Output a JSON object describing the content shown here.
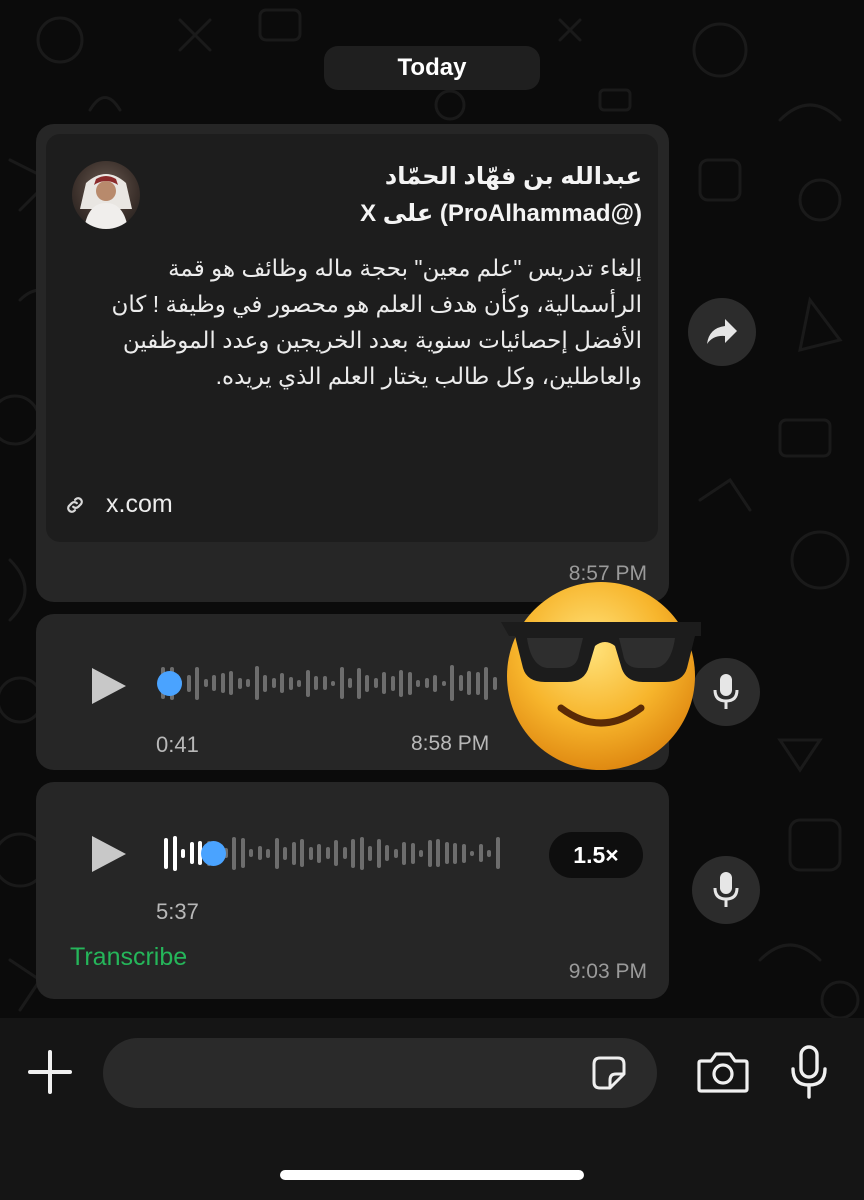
{
  "chat": {
    "date_label": "Today"
  },
  "link_message": {
    "author_line": "عبدالله بن فهّاد الحمّاد",
    "handle_line": "(@ProAlhammad) على X",
    "body": "إلغاء تدريس \"علم معين\" بحجة ماله وظائف هو قمة الرأسمالية، وكأن هدف العلم هو محصور في وظيفة ! كان الأفضل إحصائيات سنوية بعدد الخريجين وعدد الموظفين والعاطلين، وكل طالب يختار العلم الذي يريده.",
    "link_domain": "x.com",
    "time": "8:57 PM",
    "avatar_icon": "person-avatar-icon",
    "link_icon": "link-icon"
  },
  "voice_1": {
    "duration": "0:41",
    "time": "8:58 PM",
    "progress": 0
  },
  "voice_2": {
    "duration": "5:37",
    "time": "9:03 PM",
    "speed": "1.5×",
    "transcribe_label": "Transcribe",
    "progress": 0.12
  },
  "colors": {
    "accent_blue": "#4aa3ff",
    "transcribe_green": "#25b65a",
    "bubble": "#262626",
    "background": "#0b0b0b"
  },
  "icons": {
    "forward": "forward-arrow-icon",
    "mic": "microphone-icon",
    "plus": "plus-icon",
    "sticker": "sticker-icon",
    "camera": "camera-icon",
    "emoji": "sunglasses-emoji-icon"
  }
}
